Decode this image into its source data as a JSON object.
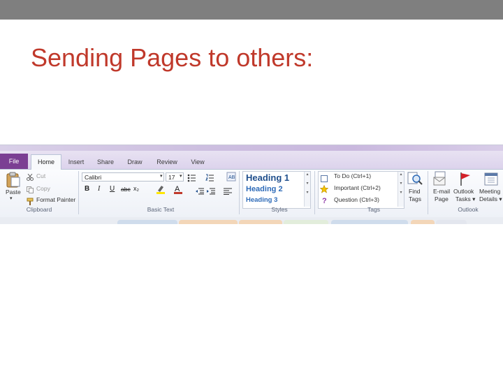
{
  "slide": {
    "title": "Sending Pages to others:",
    "title_color": "#c0392b",
    "topbar_color": "#7f7f7f"
  },
  "ribbon": {
    "tabs": {
      "file": "File",
      "home": "Home",
      "insert": "Insert",
      "share": "Share",
      "draw": "Draw",
      "review": "Review",
      "view": "View"
    },
    "clipboard": {
      "paste": "Paste",
      "cut": "Cut",
      "copy": "Copy",
      "format_painter": "Format Painter",
      "group_label": "Clipboard"
    },
    "basic_text": {
      "font_name": "Calibri",
      "font_size": "17",
      "bold": "B",
      "italic": "I",
      "underline": "U",
      "strike": "abc",
      "subscript": "x₂",
      "group_label": "Basic Text"
    },
    "styles": {
      "heading1": "Heading 1",
      "heading2": "Heading 2",
      "heading3": "Heading 3",
      "group_label": "Styles"
    },
    "tags": {
      "todo": "To Do (Ctrl+1)",
      "important": "Important (Ctrl+2)",
      "question": "Question (Ctrl+3)",
      "find_tags_1": "Find",
      "find_tags_2": "Tags",
      "group_label": "Tags"
    },
    "outlook": {
      "email_1": "E-mail",
      "email_2": "Page",
      "tasks_1": "Outlook",
      "tasks_2": "Tasks ▾",
      "meeting_1": "Meeting",
      "meeting_2": "Details ▾",
      "group_label": "Outlook"
    },
    "accent_color": "#7b3f93",
    "heading_color": "#1f4e8c"
  }
}
